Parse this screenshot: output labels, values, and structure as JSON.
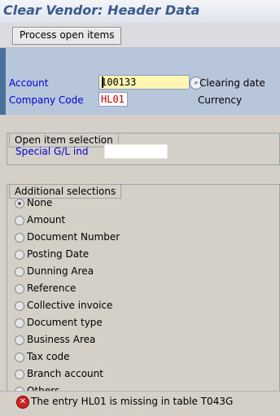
{
  "window": {
    "title": "Clear Vendor: Header Data"
  },
  "toolbar": {
    "process_open_items": "Process open items"
  },
  "header": {
    "account_label": "Account",
    "account_value": "100133",
    "clearing_date_label": "Clearing date",
    "company_code_label": "Company Code",
    "company_code_value": "HL01",
    "currency_label": "Currency"
  },
  "open_item_selection": {
    "title": "Open item selection",
    "special_gl_label": "Special G/L ind",
    "special_gl_value": ""
  },
  "additional_selections": {
    "title": "Additional selections",
    "options": [
      "None",
      "Amount",
      "Document Number",
      "Posting Date",
      "Dunning Area",
      "Reference",
      "Collective invoice",
      "Document type",
      "Business Area",
      "Tax code",
      "Branch account",
      "Others"
    ],
    "selected": "None"
  },
  "status": {
    "type": "error",
    "message": "The entry HL01   is missing in table T043G"
  },
  "colors": {
    "title": "#3a5a8c",
    "label_blue": "#0000d8",
    "required_field": "#fff6b4",
    "error": "#cc2222"
  }
}
